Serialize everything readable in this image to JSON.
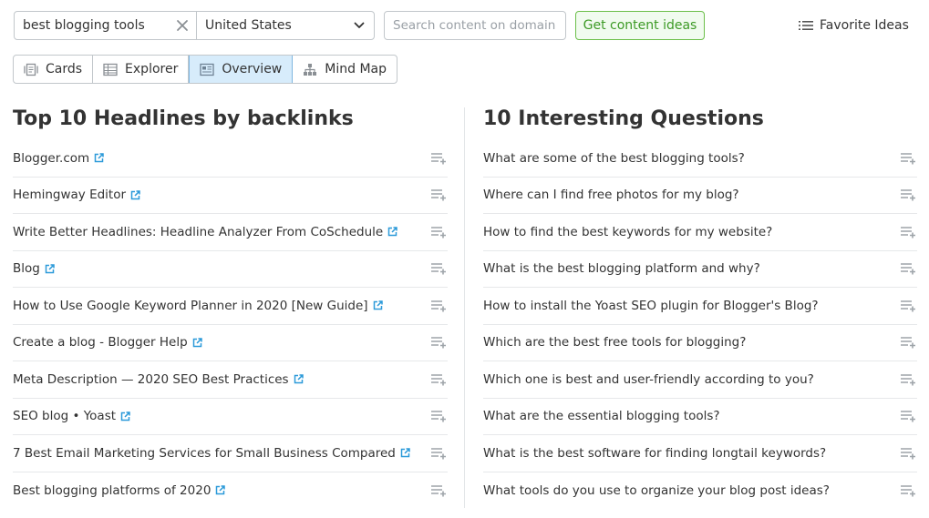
{
  "search": {
    "keyword": "best blogging tools",
    "country": "United States",
    "domain_placeholder": "Search content on domain",
    "submit_label": "Get content ideas"
  },
  "favorites_label": "Favorite Ideas",
  "tabs": [
    {
      "label": "Cards",
      "icon": "cards-icon",
      "active": false
    },
    {
      "label": "Explorer",
      "icon": "table-icon",
      "active": false
    },
    {
      "label": "Overview",
      "icon": "overview-icon",
      "active": true
    },
    {
      "label": "Mind Map",
      "icon": "mind-map-icon",
      "active": false
    }
  ],
  "headlines": {
    "title": "Top 10 Headlines by backlinks",
    "items": [
      "Blogger.com",
      "Hemingway Editor",
      "Write Better Headlines: Headline Analyzer From CoSchedule",
      "Blog",
      "How to Use Google Keyword Planner in 2020 [New Guide]",
      "Create a blog - Blogger Help",
      "Meta Description — 2020 SEO Best Practices",
      "SEO blog • Yoast",
      "7 Best Email Marketing Services for Small Business Compared",
      "Best blogging platforms of 2020"
    ]
  },
  "questions": {
    "title": "10 Interesting Questions",
    "items": [
      "What are some of the best blogging tools?",
      "Where can I find free photos for my blog?",
      "How to find the best keywords for my website?",
      "What is the best blogging platform and why?",
      "How to install the Yoast SEO plugin for Blogger's Blog?",
      "Which are the best free tools for blogging?",
      "Which one is best and user-friendly according to you?",
      "What are the essential blogging tools?",
      "What is the best software for finding longtail keywords?",
      "What tools do you use to organize your blog post ideas?"
    ]
  },
  "colors": {
    "accent_green": "#3d9a26",
    "link_blue": "#2c9ad9",
    "active_tab_bg": "#d7ecfb",
    "icon_gray": "#9ea4a9"
  }
}
